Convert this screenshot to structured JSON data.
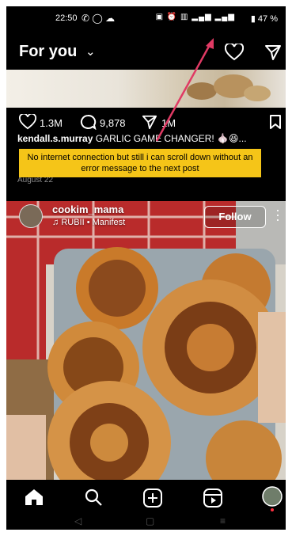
{
  "status_bar": {
    "time": "22:50",
    "battery": "47 %"
  },
  "header": {
    "title": "For you"
  },
  "post1": {
    "likes": "1.3M",
    "comments": "9,878",
    "shares": "1M",
    "username": "kendall.s.murray",
    "caption": "GARLIC GAME CHANGER! 🧄😆...",
    "date": "August 22"
  },
  "annotation": {
    "text": "No internet connection but still i can scroll down without an error message to the next post",
    "color": "#f5c518",
    "arrow_color": "#e03a64"
  },
  "post2": {
    "username": "cookim_mama",
    "music": "RUBII • Manifest",
    "follow_label": "Follow"
  },
  "icons": [
    "heart-icon",
    "send-icon",
    "comment-icon",
    "bookmark-icon",
    "home-icon",
    "search-icon",
    "add-icon",
    "reels-icon",
    "profile-avatar"
  ]
}
